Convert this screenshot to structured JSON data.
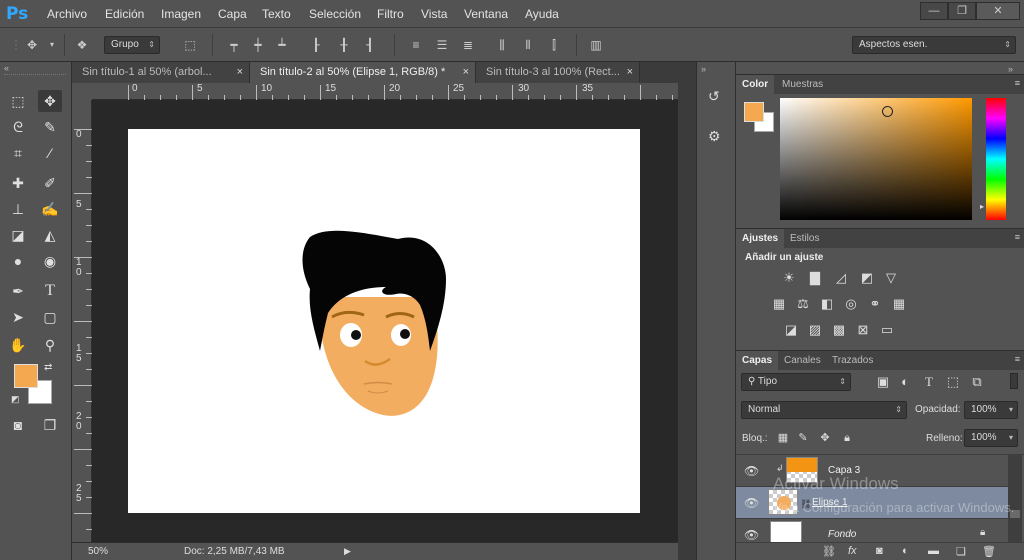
{
  "app": {
    "logo": "Ps"
  },
  "menu": [
    "Archivo",
    "Edición",
    "Imagen",
    "Capa",
    "Texto",
    "Selección",
    "Filtro",
    "Vista",
    "Ventana",
    "Ayuda"
  ],
  "window_controls": {
    "minimize": "—",
    "restore": "❐",
    "close": "✕"
  },
  "options_bar": {
    "auto_select_value": "Grupo",
    "workspace": "Aspectos esen."
  },
  "tabs": [
    {
      "title": "Sin título-1 al 50% (arbol...",
      "close": "×"
    },
    {
      "title": "Sin título-2 al 50% (Elipse 1, RGB/8) *",
      "close": "×"
    },
    {
      "title": "Sin título-3 al 100% (Rect...",
      "close": "×"
    }
  ],
  "ruler_h": [
    "0",
    "5",
    "10",
    "15",
    "20",
    "25",
    "30",
    "35"
  ],
  "ruler_v": [
    "0",
    "5",
    "10",
    "15",
    "20",
    "25"
  ],
  "status": {
    "zoom": "50%",
    "doc": "Doc: 2,25 MB/7,43 MB"
  },
  "colors": {
    "foreground": "#f4a950",
    "background": "#ffffff",
    "face": "#f3ad60",
    "hair": "#050505",
    "accent": "#31a8ff"
  },
  "color_panel": {
    "tabs": [
      "Color",
      "Muestras"
    ]
  },
  "adjust_panel": {
    "tabs": [
      "Ajustes",
      "Estilos"
    ],
    "title": "Añadir un ajuste"
  },
  "layers_panel": {
    "tabs": [
      "Capas",
      "Canales",
      "Trazados"
    ],
    "filter": "Tipo",
    "blend_mode": "Normal",
    "opacity_label": "Opacidad:",
    "opacity": "100%",
    "lock_label": "Bloq.:",
    "fill_label": "Relleno:",
    "fill": "100%",
    "layers": [
      {
        "name": "Capa 3",
        "selected": false
      },
      {
        "name": "Elipse 1",
        "selected": true
      },
      {
        "name": "Fondo",
        "selected": false
      }
    ]
  },
  "activation": {
    "title": "Activar Windows",
    "subtitle": "Ve a Configuración para activar Windows."
  },
  "icons": [
    "move-icon",
    "marquee-icon",
    "lasso-icon",
    "quick-select-icon",
    "crop-icon",
    "eyedropper-icon",
    "healing-icon",
    "brush-icon",
    "stamp-icon",
    "history-brush-icon",
    "eraser-icon",
    "bucket-icon",
    "blur-icon",
    "dodge-icon",
    "pen-icon",
    "type-icon",
    "path-select-icon",
    "shape-icon",
    "hand-icon",
    "zoom-icon",
    "eye-icon",
    "lock-icon",
    "trash-icon"
  ]
}
